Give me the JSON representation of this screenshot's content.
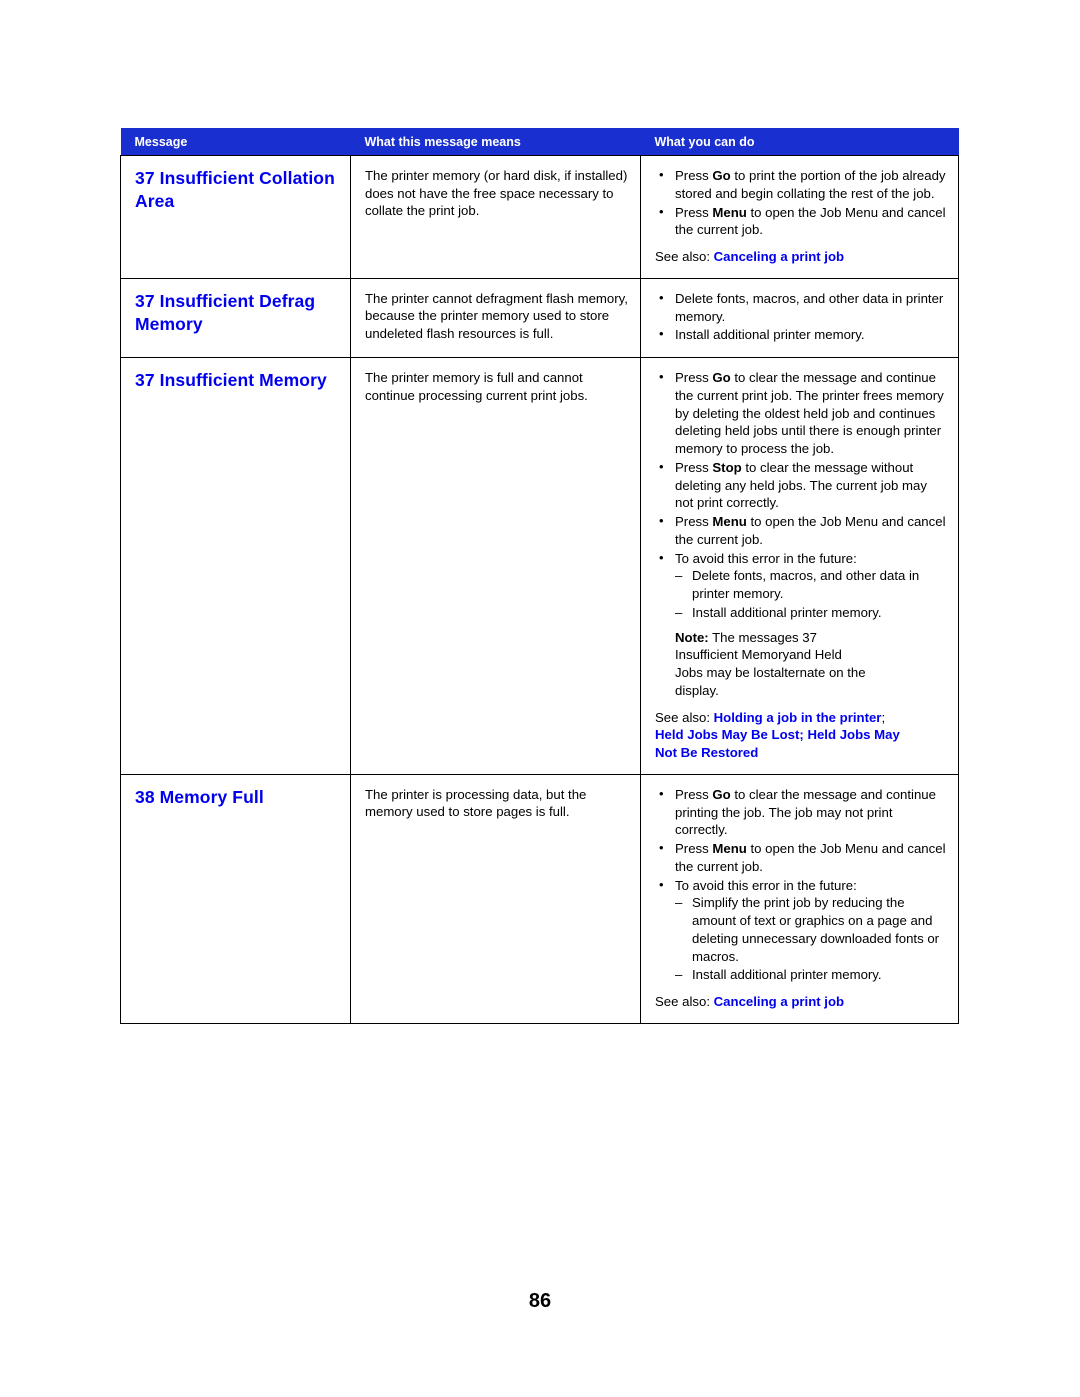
{
  "page": {
    "number": "86"
  },
  "table": {
    "headers": [
      "Message",
      "What this message means",
      "What you can do"
    ],
    "rows": [
      {
        "message": "37 Insufficient Collation Area",
        "means": "The printer memory (or hard disk, if installed) does not have the free space necessary to collate the print job.",
        "actions": [
          "Press Go to print the portion of the job already stored and begin collating the rest of the job.",
          "Press Menu to open the Job Menu and cancel the current job."
        ],
        "action_bold": [
          [
            "Go"
          ],
          [
            "Menu"
          ]
        ],
        "see_also_prefix": "See also: ",
        "see_also_links": "Canceling a print job"
      },
      {
        "message": "37 Insufficient Defrag Memory",
        "means": "The printer cannot defragment flash memory, because the printer memory used to store undeleted flash resources is full.",
        "actions": [
          "Delete fonts, macros, and other data in printer memory.",
          "Install additional printer memory."
        ]
      },
      {
        "message": "37 Insufficient Memory",
        "means": "The printer memory is full and cannot continue processing current print jobs.",
        "actions": [
          "Press Go to clear the message and continue the current print job. The printer frees memory by deleting the oldest held job and continues deleting held jobs until there is enough printer memory to process the job.",
          "Press Stop to clear the message without deleting any held jobs. The current job may not print correctly.",
          "Press Menu to open the Job Menu and cancel the current job.",
          "To avoid this error in the future:"
        ],
        "sub_actions": [
          "Delete fonts, macros, and other data in printer memory.",
          "Install additional printer memory."
        ],
        "note": {
          "label": "Note:",
          "line1": " The messages 37",
          "line2a": "Insufficient Memory",
          "line2b": "and Held",
          "line3a": "Jobs may be lost",
          "line3b": "alternate on the",
          "line4": "display."
        },
        "see_also_prefix": "See also: ",
        "see_also_links": "Holding a job in the printer",
        "see_also_semicolon": ";",
        "see_also_line2a": "Held Jobs May Be Lost",
        "see_also_line2sep": ";",
        "see_also_line2b": "Held Jobs May",
        "see_also_line3": "Not Be Restored"
      },
      {
        "message": "38 Memory Full",
        "means": "The printer is processing data, but the memory used to store pages is full.",
        "actions": [
          "Press Go to clear the message and continue printing the job. The job may not print correctly.",
          "Press Menu to open the Job Menu and cancel the current job.",
          "To avoid this error in the future:"
        ],
        "sub_actions": [
          "Simplify the print job by reducing the amount of text or graphics on a page and deleting unnecessary downloaded fonts or macros.",
          "Install additional printer memory."
        ],
        "see_also_prefix": "See also: ",
        "see_also_links": "Canceling a print job"
      }
    ]
  },
  "colors": {
    "header_bg": "#1a2fd0",
    "link": "#0000ee"
  }
}
